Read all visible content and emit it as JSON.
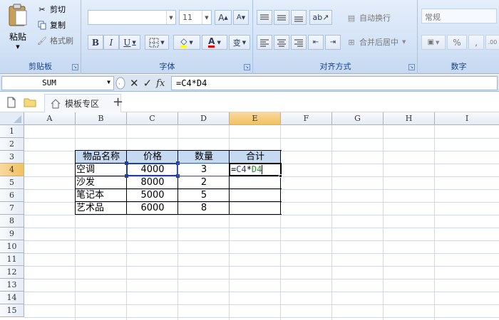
{
  "ribbon": {
    "clipboard": {
      "paste": "粘贴",
      "cut": "剪切",
      "copy": "复制",
      "format_painter": "格式刷",
      "label": "剪贴板"
    },
    "font": {
      "font_name": "",
      "font_size": "11",
      "bold": "B",
      "italic": "I",
      "underline": "U",
      "label": "字体"
    },
    "alignment": {
      "wrap_text": "自动换行",
      "merge_center": "合并后居中",
      "label": "对齐方式"
    },
    "number": {
      "format": "常规",
      "percent": "%",
      "comma": ",",
      "label": "数字"
    }
  },
  "formula_bar": {
    "name_box": "SUM",
    "fx": "fx",
    "formula": "=C4*D4"
  },
  "tabs": {
    "active_tab": "模板专区",
    "add": "+"
  },
  "columns": [
    "A",
    "B",
    "C",
    "D",
    "E",
    "F",
    "G",
    "H",
    "I"
  ],
  "rows": [
    "1",
    "2",
    "3",
    "4",
    "5",
    "6",
    "7",
    "8",
    "9",
    "10",
    "11",
    "12",
    "13",
    "14",
    "15"
  ],
  "table": {
    "headers": [
      "物品名称",
      "价格",
      "数量",
      "合计"
    ],
    "rows": [
      {
        "name": "空调",
        "price": "4000",
        "qty": "3",
        "total": "=C4*D4"
      },
      {
        "name": "沙发",
        "price": "8000",
        "qty": "2",
        "total": ""
      },
      {
        "name": "笔记本",
        "price": "5000",
        "qty": "5",
        "total": ""
      },
      {
        "name": "艺术品",
        "price": "6000",
        "qty": "8",
        "total": ""
      }
    ]
  },
  "editing_formula": {
    "prefix": "=",
    "ref1": "C4",
    "op": "*",
    "ref2": "D4"
  },
  "colors": {
    "ref_c4": "#1f3da8",
    "ref_d4": "#2e8b2e",
    "header_fill": "#c5d9f1",
    "active_header": "#f1c15f"
  }
}
